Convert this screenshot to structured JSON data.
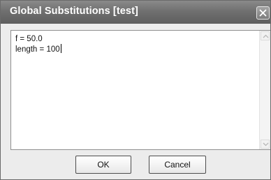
{
  "window": {
    "title": "Global Substitutions [test]",
    "close_icon": "close-icon"
  },
  "editor": {
    "lines": [
      "f = 50.0",
      "length = 100"
    ]
  },
  "buttons": {
    "ok_label": "OK",
    "cancel_label": "Cancel"
  }
}
